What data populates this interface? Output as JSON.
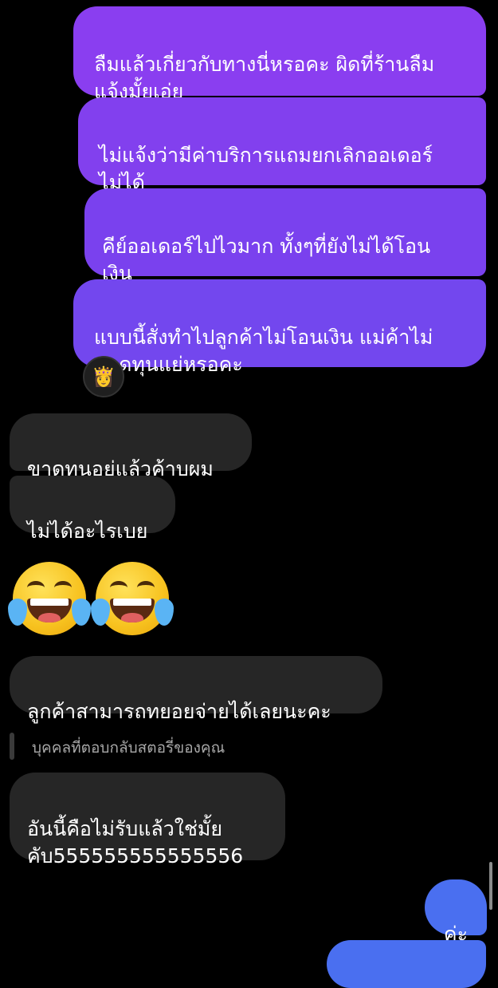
{
  "sent_messages": [
    {
      "text": "ลืมแล้วเกี่ยวกับทางนี่หรอคะ ผิดที่ร้านลืม\nแจ้งมั้ยเอ่ย"
    },
    {
      "text": "ไม่แจ้งว่ามีค่าบริการแถมยกเลิกออเดอร์\nไม่ได้"
    },
    {
      "text": "คีย์ออเดอร์ไปไวมาก ทั้งๆที่ยังไม่ได้โอน\nเงิน"
    },
    {
      "text": "แบบนี้สั่งทำไปลูกค้าไม่โอนเงิน แม่ค้าไม่\nขาดทุนแย่หรอคะ"
    }
  ],
  "reaction_avatar": {
    "icon": "person-with-crown-emoji"
  },
  "received_messages": [
    {
      "text": "ขาดทุนอยู่แล้วค้าบผม"
    },
    {
      "text": "ไม่ได้อะไรเบย"
    },
    {
      "text": "ลูกค้าสามารถทยอยจ่ายได้เลยนะคะ"
    },
    {
      "text": "อันนี้คือไม่รับแล้วใช่มั้ย\nคับ555555555555556"
    }
  ],
  "emojis": [
    {
      "icon": "face-with-tears-of-joy-emoji"
    },
    {
      "icon": "face-with-tears-of-joy-emoji"
    }
  ],
  "story_reply_label": "บุคคลที่ตอบกลับสตอรี่ของคุณ",
  "last_sent_message": {
    "text": "ค่ะ"
  },
  "colors": {
    "sent_bubble": "#7e3ff0",
    "received_bubble": "#262626",
    "last_sent_bubble": "#4a6ff0",
    "background": "#000000"
  }
}
